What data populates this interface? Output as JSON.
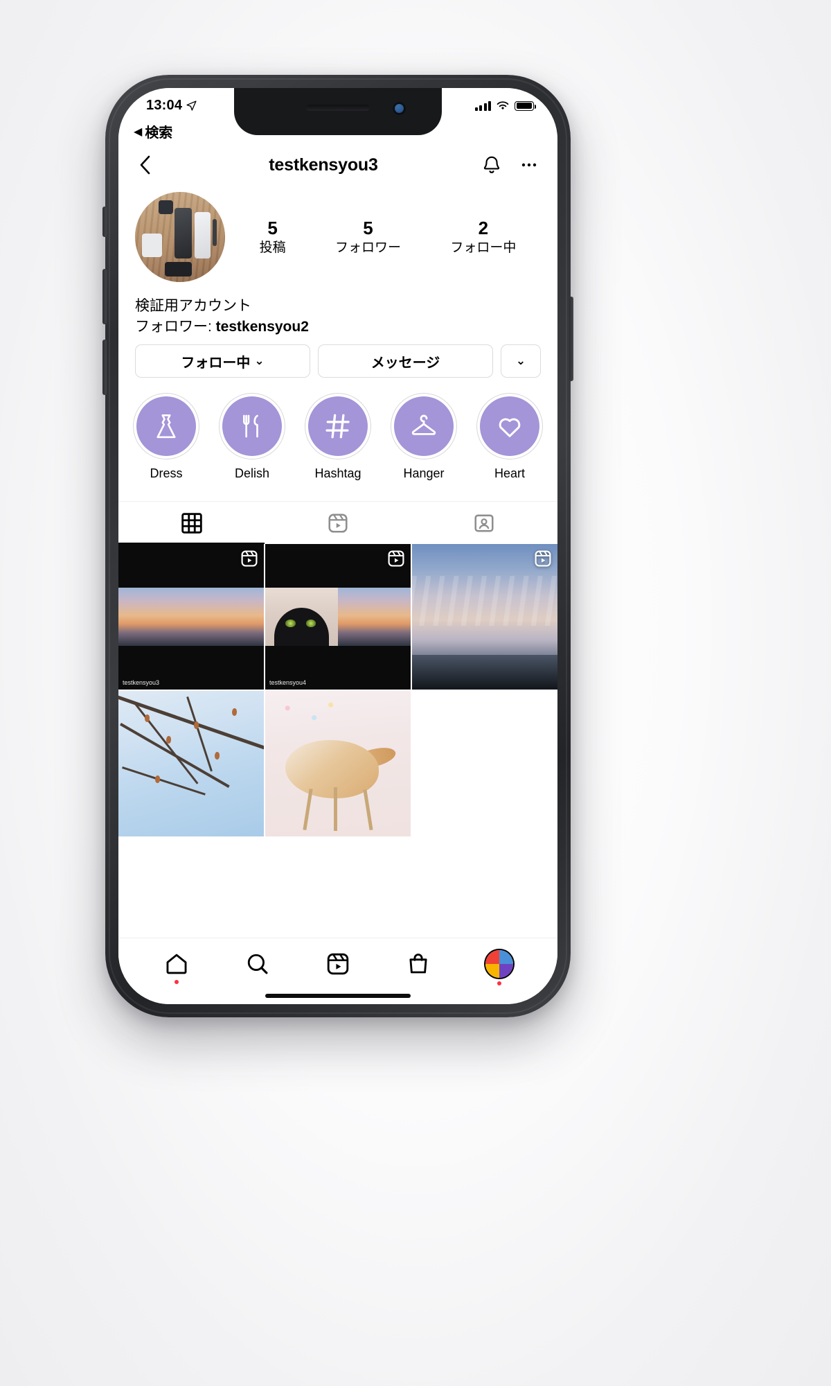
{
  "status_bar": {
    "time": "13:04",
    "location_icon": "location-arrow-icon",
    "signal_icon": "cellular-signal-icon",
    "wifi_icon": "wifi-icon",
    "battery_icon": "battery-full-icon"
  },
  "back_to_app": {
    "arrow": "◀",
    "label": "検索"
  },
  "nav": {
    "back_icon": "chevron-left-icon",
    "title": "testkensyou3",
    "bell_icon": "bell-icon",
    "more_icon": "ellipsis-icon"
  },
  "profile": {
    "avatar_alt": "profile-photo",
    "stats": [
      {
        "number": "5",
        "label": "投稿"
      },
      {
        "number": "5",
        "label": "フォロワー"
      },
      {
        "number": "2",
        "label": "フォロー中"
      }
    ],
    "bio_name": "検証用アカウント",
    "bio_followers_prefix": "フォロワー: ",
    "bio_followers_value": "testkensyou2"
  },
  "actions": {
    "follow_label": "フォロー中",
    "follow_caret": "⌄",
    "message_label": "メッセージ",
    "more_caret": "⌄"
  },
  "highlights_accent": "#a494d8",
  "highlights": [
    {
      "label": "Dress",
      "icon": "dress-icon"
    },
    {
      "label": "Delish",
      "icon": "fork-knife-icon"
    },
    {
      "label": "Hashtag",
      "icon": "hashtag-icon"
    },
    {
      "label": "Hanger",
      "icon": "hanger-icon"
    },
    {
      "label": "Heart",
      "icon": "heart-icon"
    }
  ],
  "tabs": [
    {
      "name": "grid-tab",
      "icon": "grid-icon",
      "active": true
    },
    {
      "name": "reels-tab",
      "icon": "reels-icon",
      "active": false
    },
    {
      "name": "tagged-tab",
      "icon": "tagged-icon",
      "active": false
    }
  ],
  "posts": [
    {
      "type": "reel",
      "art": "black-sunset-strip",
      "badge": "reels-icon",
      "caption": "testkensyou3"
    },
    {
      "type": "reel",
      "art": "black-cat-sunset",
      "badge": "reels-icon",
      "caption": "testkensyou4"
    },
    {
      "type": "reel",
      "art": "sunset-full",
      "badge": "reels-icon",
      "caption": ""
    },
    {
      "type": "photo",
      "art": "winter-branches",
      "badge": "",
      "caption": ""
    },
    {
      "type": "photo",
      "art": "ginger-cat",
      "badge": "",
      "caption": ""
    }
  ],
  "bottom_nav": [
    {
      "name": "home-tab",
      "icon": "home-icon",
      "badge_dot": true
    },
    {
      "name": "search-tab",
      "icon": "search-icon",
      "badge_dot": false
    },
    {
      "name": "reels-tab",
      "icon": "reels-icon",
      "badge_dot": false
    },
    {
      "name": "shop-tab",
      "icon": "shop-bag-icon",
      "badge_dot": false
    },
    {
      "name": "profile-tab",
      "icon": "avatar-icon",
      "badge_dot": true
    }
  ]
}
